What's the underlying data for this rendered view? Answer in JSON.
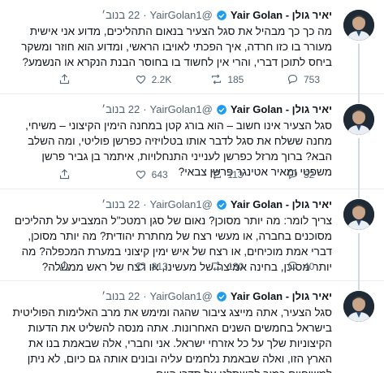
{
  "accent": "#1d9bf0",
  "icons": [
    "reply-icon",
    "retweet-icon",
    "like-icon",
    "share-icon",
    "verified-badge-icon"
  ],
  "tweets": [
    {
      "name": "יאיר גולן - Yair Golan",
      "handle": "@YairGolan1",
      "dot": "·",
      "time": "22 בנוב׳",
      "text": "מה כך כך מבהיל את סגל הצעיר בנאום התהליכים, מדוע אני אישית מעורר בו כזו חרדה, איך הפכתי לאויבו הראשי, ומדוע הוא חוזר ומשקר ביחס לתוכן דברי, והרי אין לחשוד בו בחוסר הבנת הנקרא או הנשמע?",
      "replies": "753",
      "retweets": "185",
      "likes": "2.2K"
    },
    {
      "name": "יאיר גולן - Yair Golan",
      "handle": "@YairGolan1",
      "dot": "·",
      "time": "22 בנוב׳",
      "text": "סגל הצעיר אינו חשוב – הוא בורג קטן במחנה הימין הקיצוני – משיחי, מחנה ששלח את סגל לדבר אותו בטלויזיה כפרשן פוליטי, ומה השלב הבא? ברוך מרזל כפרשן לענייני התנחלויות, איתמר בן גביר פרשן משפטי ומאיר אטינגר פרשן צבאי?",
      "replies": "52",
      "retweets": "113",
      "likes": "643"
    },
    {
      "name": "יאיר גולן - Yair Golan",
      "handle": "@YairGolan1",
      "dot": "·",
      "time": "22 בנוב׳",
      "text": "צריך לומר: מה יותר מסוכן? נאום של סגן רמטכ\"ל המצביע על תהליכים מסוכנים בחברה, או מעשי רצח של מחתרת יהודית? מה יותר מסוכן, דברי אמת מוכיחים, או רצח של איש ימין קיצוני במערת המכפלה? מה יותר מסוכן, בחינה אמיצה של מעשינו, או רצח של ראש ממשלה?",
      "replies": "40",
      "retweets": "130",
      "likes": "813"
    },
    {
      "name": "יאיר גולן - Yair Golan",
      "handle": "@YairGolan1",
      "dot": "·",
      "time": "22 בנוב׳",
      "text": "סגל הצעיר, אתה מייצג ציבור שהגה ומימש את מרב האלימות הפוליטית בישראל בחמשים השנים האחרונות. אתה מנסה להשליט את הדעות הקיצוניות שלך על כל אזרחי ישראל. אני וחברי, אלה שבאמת בנו את הארץ הזו, ואלה שבאמת נלחמים עליה ובונים אותה גם כיום, לא ניתן למשיחיים כמוך להשתלט על סדרי היום.",
      "replies": "",
      "retweets": "",
      "likes": ""
    }
  ]
}
